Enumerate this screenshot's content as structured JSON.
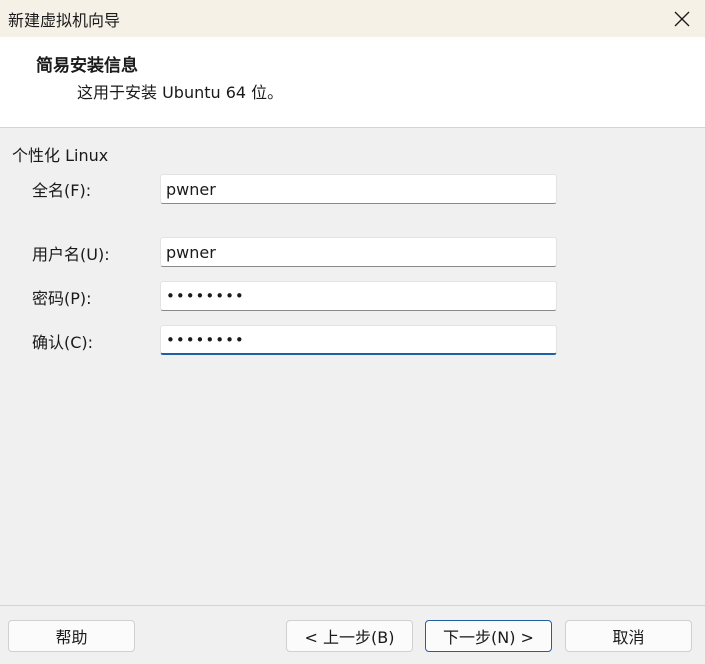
{
  "window": {
    "title": "新建虚拟机向导"
  },
  "header": {
    "title": "简易安装信息",
    "subtitle": "这用于安装 Ubuntu 64 位。"
  },
  "personalize": {
    "group_label": "个性化 Linux",
    "fullname": {
      "label": "全名(F):",
      "value": "pwner"
    },
    "username": {
      "label": "用户名(U):",
      "value": "pwner"
    },
    "password": {
      "label": "密码(P):",
      "value": "••••••••"
    },
    "confirm": {
      "label": "确认(C):",
      "value": "••••••••"
    }
  },
  "footer": {
    "help": "帮助",
    "back": "< 上一步(B)",
    "next": "下一步(N) >",
    "cancel": "取消"
  },
  "colors": {
    "accent": "#1f5fa8",
    "titlebar_bg": "#f6f1e7"
  }
}
